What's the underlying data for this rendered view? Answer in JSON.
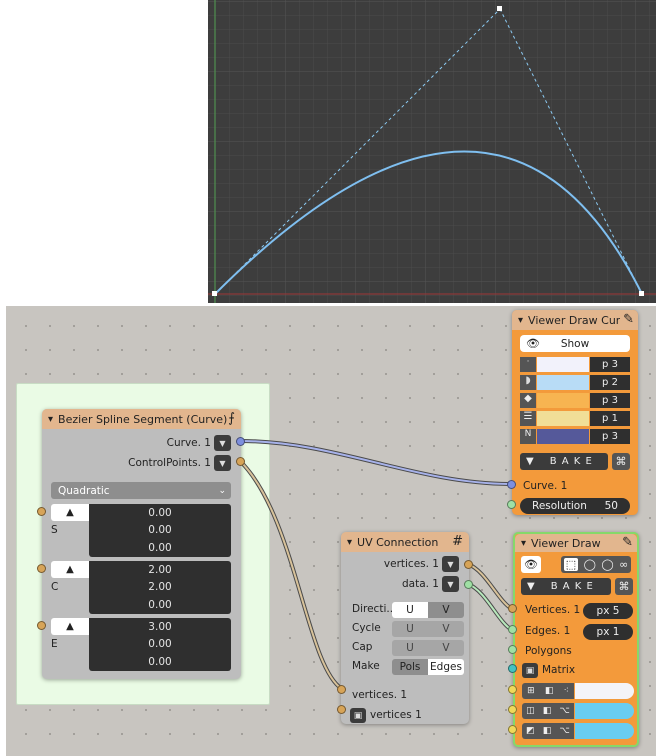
{
  "bezier_node": {
    "title": "Bezier Spline Segment (Curve)",
    "outputs": [
      "Curve. 1",
      "ControlPoints. 1"
    ],
    "mode": "Quadratic",
    "groups": [
      {
        "label": "S",
        "values": [
          "0.00",
          "0.00",
          "0.00"
        ]
      },
      {
        "label": "C",
        "values": [
          "2.00",
          "2.00",
          "0.00"
        ]
      },
      {
        "label": "E",
        "values": [
          "3.00",
          "0.00",
          "0.00"
        ]
      }
    ]
  },
  "uv_node": {
    "title": "UV Connection",
    "outputs": [
      "vertices. 1",
      "data. 1"
    ],
    "rows": [
      {
        "label": "Directi..",
        "a": "U",
        "b": "V"
      },
      {
        "label": "Cycle",
        "a": "U",
        "b": "V"
      },
      {
        "label": "Cap",
        "a": "U",
        "b": "V"
      },
      {
        "label": "Make",
        "a": "Pols",
        "b": "Edges"
      }
    ],
    "inputs": [
      "vertices. 1",
      "vertices 1"
    ]
  },
  "viewer_curve_node": {
    "title": "Viewer Draw Curv",
    "show_label": "Show",
    "rows": [
      {
        "value": "p  3",
        "color": "#f2f2fb"
      },
      {
        "value": "p  2",
        "color": "#b8dcf6"
      },
      {
        "value": "p  3",
        "color": "#f7b451"
      },
      {
        "value": "p  1",
        "color": "#f1de97"
      },
      {
        "value": "p  3",
        "color": "#55599a"
      }
    ],
    "bake_label": "B A K E",
    "input_label": "Curve. 1",
    "resolution_label": "Resolution",
    "resolution_value": "50"
  },
  "viewer_draw_node": {
    "title": "Viewer Draw",
    "bake_label": "B A K E",
    "vertices_label": "Vertices. 1",
    "vertices_size": "px  5",
    "edges_label": "Edges. 1",
    "edges_size": "px  1",
    "polygons_label": "Polygons",
    "matrix_label": "Matrix",
    "color_rows": [
      "#f4f4f8",
      "#69cdf1",
      "#69cdf1"
    ]
  },
  "colors": {
    "node_bg": "#bdbdbd",
    "header_tan": "#e2b68e",
    "viewer_orange": "#f39a3b",
    "frame_green": "#eafbe5",
    "curve_blue": "#7fbff0"
  }
}
